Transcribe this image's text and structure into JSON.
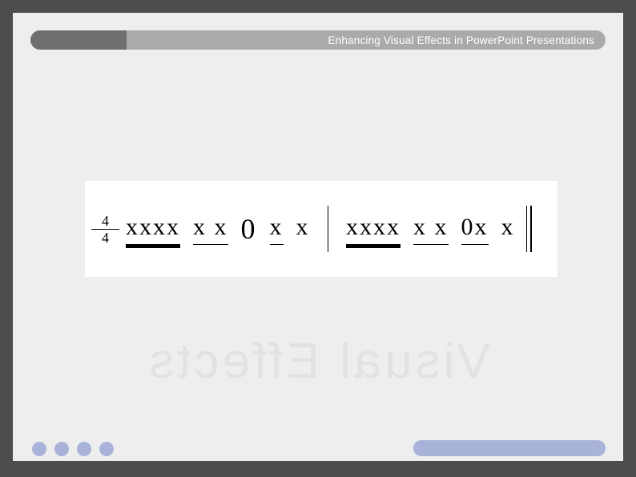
{
  "header": {
    "title": "Enhancing Visual Effects in PowerPoint Presentations"
  },
  "notation": {
    "time_signature": {
      "numerator": "4",
      "denominator": "4"
    },
    "measure1": {
      "group1": "xxxx",
      "group2": "x x",
      "zero": "0",
      "group3": "x",
      "free": "x"
    },
    "measure2": {
      "group1": "xxxx",
      "group2": "x x",
      "zerogrp": "0x",
      "free": "x"
    }
  },
  "watermark": "Visual Effects"
}
